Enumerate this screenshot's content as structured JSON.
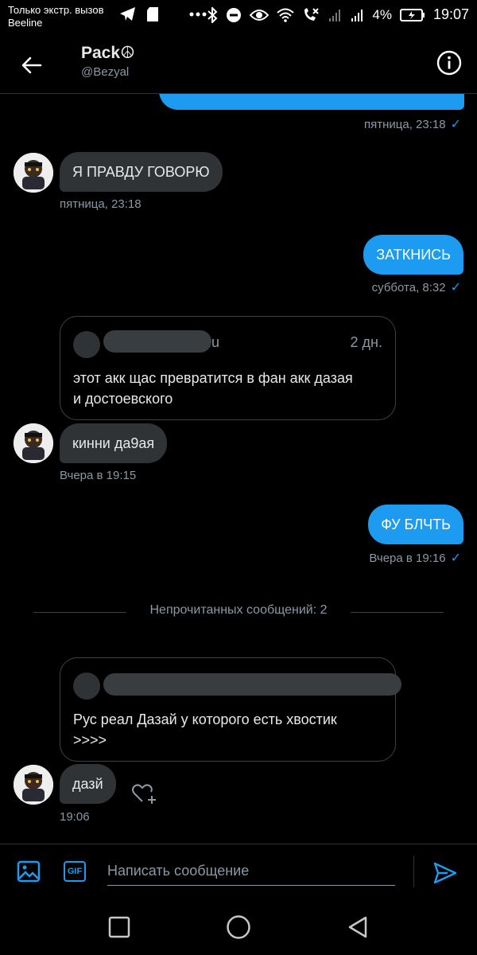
{
  "status_bar": {
    "line1": "Только экстр. вызов",
    "line2": "Beeline",
    "battery": "4%",
    "time": "19:07"
  },
  "header": {
    "title": "Pack☮",
    "handle": "@Bezyal"
  },
  "messages": {
    "m1_meta": "пятница, 23:18",
    "m2_text": "Я ПРАВДУ ГОВОРЮ",
    "m2_meta": "пятница, 23:18",
    "m3_text": "ЗАТКНИСЬ",
    "m3_meta": "суббота, 8:32",
    "q1_suffix": "u",
    "q1_date": "2 дн.",
    "q1_text_line1": "этот акк щас превратится в фан акк дазая",
    "q1_text_line2": "и достоевского",
    "m4_text": "кинни да9ая",
    "m4_meta": "Вчера в 19:15",
    "m5_text": "ФУ БЛЧТЬ",
    "m5_meta": "Вчера в 19:16",
    "unread_label": "Непрочитанных сообщений: 2",
    "q2_text_line1": "Рус реал Дазай у которого есть хвостик",
    "q2_text_line2": ">>>>",
    "m6_text": "дазй",
    "m6_meta": "19:06"
  },
  "composer": {
    "placeholder": "Написать сообщение",
    "gif_label": "GIF"
  },
  "colors": {
    "accent": "#1d9bf0",
    "background": "#000000",
    "incoming_bubble": "#2f3336",
    "muted_text": "#8b98a5"
  }
}
